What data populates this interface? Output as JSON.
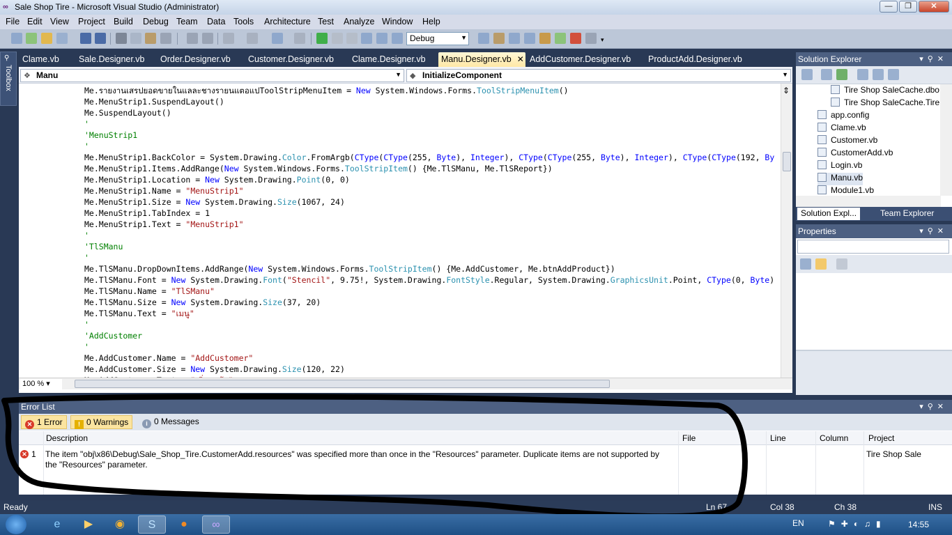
{
  "window": {
    "title": "Sale Shop Tire - Microsoft Visual Studio (Administrator)",
    "minimize": "—",
    "restore": "❐",
    "close": "✕"
  },
  "menu": [
    "File",
    "Edit",
    "View",
    "Project",
    "Build",
    "Debug",
    "Team",
    "Data",
    "Tools",
    "Architecture",
    "Test",
    "Analyze",
    "Window",
    "Help"
  ],
  "toolbar": {
    "configuration": "Debug"
  },
  "toolbox": {
    "label": "Toolbox"
  },
  "doc_tabs": [
    "Clame.vb",
    "Sale.Designer.vb",
    "Order.Designer.vb",
    "Customer.Designer.vb",
    "Clame.Designer.vb",
    "Manu.Designer.vb",
    "AddCustomer.Designer.vb",
    "ProductAdd.Designer.vb"
  ],
  "active_tab_close": "✕",
  "nav": {
    "left": "Manu",
    "right": "InitializeComponent"
  },
  "code": [
    [
      {
        "t": "Me.รายงานเสรปยอดขายในแลละชางรายนแตอแปToolStripMenuItem = "
      },
      {
        "t": "New",
        "c": "kw"
      },
      {
        "t": " System.Windows.Forms."
      },
      {
        "t": "ToolStripMenuItem",
        "c": "ty"
      },
      {
        "t": "()"
      }
    ],
    [
      {
        "t": "Me.MenuStrip1.SuspendLayout()"
      }
    ],
    [
      {
        "t": "Me.SuspendLayout()"
      }
    ],
    [
      {
        "t": "'",
        "c": "cm"
      }
    ],
    [
      {
        "t": "'MenuStrip1",
        "c": "cm"
      }
    ],
    [
      {
        "t": "'",
        "c": "cm"
      }
    ],
    [
      {
        "t": "Me.MenuStrip1.BackColor = System.Drawing."
      },
      {
        "t": "Color",
        "c": "ty"
      },
      {
        "t": ".FromArgb("
      },
      {
        "t": "CType",
        "c": "kw"
      },
      {
        "t": "("
      },
      {
        "t": "CType",
        "c": "kw"
      },
      {
        "t": "(255, "
      },
      {
        "t": "Byte",
        "c": "kw"
      },
      {
        "t": "), "
      },
      {
        "t": "Integer",
        "c": "kw"
      },
      {
        "t": "), "
      },
      {
        "t": "CType",
        "c": "kw"
      },
      {
        "t": "("
      },
      {
        "t": "CType",
        "c": "kw"
      },
      {
        "t": "(255, "
      },
      {
        "t": "Byte",
        "c": "kw"
      },
      {
        "t": "), "
      },
      {
        "t": "Integer",
        "c": "kw"
      },
      {
        "t": "), "
      },
      {
        "t": "CType",
        "c": "kw"
      },
      {
        "t": "("
      },
      {
        "t": "CType",
        "c": "kw"
      },
      {
        "t": "(192, "
      },
      {
        "t": "By",
        "c": "kw"
      }
    ],
    [
      {
        "t": "Me.MenuStrip1.Items.AddRange("
      },
      {
        "t": "New",
        "c": "kw"
      },
      {
        "t": " System.Windows.Forms."
      },
      {
        "t": "ToolStripItem",
        "c": "ty"
      },
      {
        "t": "() {Me.TlSManu, Me.TlSReport})"
      }
    ],
    [
      {
        "t": "Me.MenuStrip1.Location = "
      },
      {
        "t": "New",
        "c": "kw"
      },
      {
        "t": " System.Drawing."
      },
      {
        "t": "Point",
        "c": "ty"
      },
      {
        "t": "(0, 0)"
      }
    ],
    [
      {
        "t": "Me.MenuStrip1.Name = "
      },
      {
        "t": "\"MenuStrip1\"",
        "c": "str"
      }
    ],
    [
      {
        "t": "Me.MenuStrip1.Size = "
      },
      {
        "t": "New",
        "c": "kw"
      },
      {
        "t": " System.Drawing."
      },
      {
        "t": "Size",
        "c": "ty"
      },
      {
        "t": "(1067, 24)"
      }
    ],
    [
      {
        "t": "Me.MenuStrip1.TabIndex = 1"
      }
    ],
    [
      {
        "t": "Me.MenuStrip1.Text = "
      },
      {
        "t": "\"MenuStrip1\"",
        "c": "str"
      }
    ],
    [
      {
        "t": "'",
        "c": "cm"
      }
    ],
    [
      {
        "t": "'TlSManu",
        "c": "cm"
      }
    ],
    [
      {
        "t": "'",
        "c": "cm"
      }
    ],
    [
      {
        "t": "Me.TlSManu.DropDownItems.AddRange("
      },
      {
        "t": "New",
        "c": "kw"
      },
      {
        "t": " System.Windows.Forms."
      },
      {
        "t": "ToolStripItem",
        "c": "ty"
      },
      {
        "t": "() {Me.AddCustomer, Me.btnAddProduct})"
      }
    ],
    [
      {
        "t": "Me.TlSManu.Font = "
      },
      {
        "t": "New",
        "c": "kw"
      },
      {
        "t": " System.Drawing."
      },
      {
        "t": "Font",
        "c": "ty"
      },
      {
        "t": "("
      },
      {
        "t": "\"Stencil\"",
        "c": "str"
      },
      {
        "t": ", 9.75!, System.Drawing."
      },
      {
        "t": "FontStyle",
        "c": "ty"
      },
      {
        "t": ".Regular, System.Drawing."
      },
      {
        "t": "GraphicsUnit",
        "c": "ty"
      },
      {
        "t": ".Point, "
      },
      {
        "t": "CType",
        "c": "kw"
      },
      {
        "t": "(0, "
      },
      {
        "t": "Byte",
        "c": "kw"
      },
      {
        "t": ")"
      }
    ],
    [
      {
        "t": "Me.TlSManu.Name = "
      },
      {
        "t": "\"TlSManu\"",
        "c": "str"
      }
    ],
    [
      {
        "t": "Me.TlSManu.Size = "
      },
      {
        "t": "New",
        "c": "kw"
      },
      {
        "t": " System.Drawing."
      },
      {
        "t": "Size",
        "c": "ty"
      },
      {
        "t": "(37, 20)"
      }
    ],
    [
      {
        "t": "Me.TlSManu.Text = "
      },
      {
        "t": "\"เมนู\"",
        "c": "str"
      }
    ],
    [
      {
        "t": "'",
        "c": "cm"
      }
    ],
    [
      {
        "t": "'AddCustomer",
        "c": "cm"
      }
    ],
    [
      {
        "t": "'",
        "c": "cm"
      }
    ],
    [
      {
        "t": "Me.AddCustomer.Name = "
      },
      {
        "t": "\"AddCustomer\"",
        "c": "str"
      }
    ],
    [
      {
        "t": "Me.AddCustomer.Size = "
      },
      {
        "t": "New",
        "c": "kw"
      },
      {
        "t": " System.Drawing."
      },
      {
        "t": "Size",
        "c": "ty"
      },
      {
        "t": "(120, 22)"
      }
    ],
    [
      {
        "t": "Me.AddCustomer.Text = "
      },
      {
        "t": "\"เพิ่มลูกค้า\"",
        "c": "str"
      }
    ]
  ],
  "zoom": "100 %",
  "solution_explorer": {
    "title": "Solution Explorer",
    "items": [
      "Tire Shop SaleCache.dbo",
      "Tire Shop SaleCache.Tire",
      "app.config",
      "Clame.vb",
      "Customer.vb",
      "CustomerAdd.vb",
      "Login.vb",
      "Manu.vb",
      "Module1.vb"
    ],
    "selected": "Manu.vb",
    "tabs": [
      "Solution Expl...",
      "Team Explorer"
    ]
  },
  "properties": {
    "title": "Properties"
  },
  "error_list": {
    "title": "Error List",
    "filters": {
      "errors": "1 Error",
      "warnings": "0 Warnings",
      "messages": "0 Messages"
    },
    "columns": [
      "Description",
      "File",
      "Line",
      "Column",
      "Project"
    ],
    "rows": [
      {
        "num": "1",
        "description": "The item \"obj\\x86\\Debug\\Sale_Shop_Tire.CustomerAdd.resources\" was specified more than once in the \"Resources\" parameter.  Duplicate items are not supported by the \"Resources\" parameter.",
        "file": "",
        "line": "",
        "column": "",
        "project": "Tire Shop Sale"
      }
    ]
  },
  "status": {
    "ready": "Ready",
    "ln": "Ln 67",
    "col": "Col 38",
    "ch": "Ch 38",
    "ins": "INS"
  },
  "taskbar": {
    "lang": "EN",
    "time": "14:55"
  },
  "colors": {
    "accent": "#293955",
    "active_tab": "#ffe8a6",
    "scribble": "#000000"
  }
}
